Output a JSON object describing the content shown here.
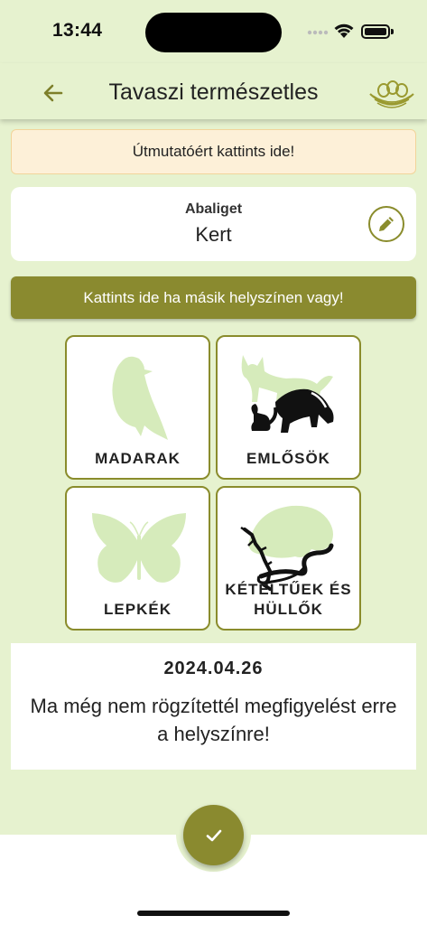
{
  "status_bar": {
    "time": "13:44"
  },
  "app_bar": {
    "title": "Tavaszi természetles"
  },
  "guide_banner": {
    "text": "Útmutatóért kattints ide!"
  },
  "location": {
    "label": "Abaliget",
    "name": "Kert"
  },
  "change_location": {
    "label": "Kattints ide ha másik helyszínen vagy!"
  },
  "categories": [
    {
      "label": "MADARAK",
      "icon": "bird-icon"
    },
    {
      "label": "EMLŐSÖK",
      "icon": "mammals-icon"
    },
    {
      "label": "LEPKÉK",
      "icon": "butterfly-icon"
    },
    {
      "label": "KÉTÉLTŰEK ÉS HÜLLŐK",
      "icon": "amphibians-reptiles-icon"
    }
  ],
  "observations": {
    "date": "2024.04.26",
    "message": "Ma még nem rögzítettél megfigyelést erre a helyszínre!"
  },
  "colors": {
    "background": "#e6f2cf",
    "accent": "#8a8a2f",
    "banner": "#fdf0d8",
    "silhouette": "#d6ebbb"
  }
}
